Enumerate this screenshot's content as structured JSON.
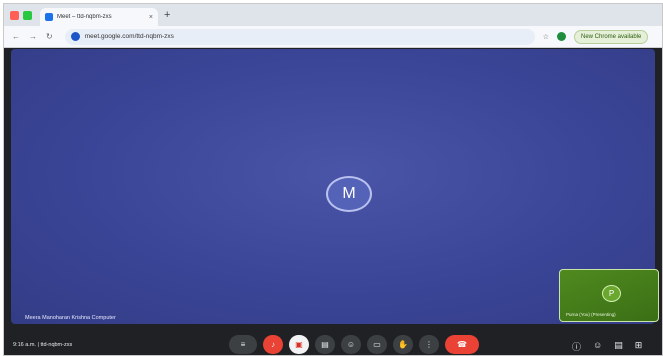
{
  "browser": {
    "tab_title": "Meet – ttd-nqbm-zxs",
    "tab_close": "×",
    "new_tab": "+",
    "url": "meet.google.com/ttd-nqbm-zxs",
    "profile": "New Chrome available",
    "nav": {
      "back": "←",
      "forward": "→",
      "reload": "↻"
    }
  },
  "meeting": {
    "main_avatar_initial": "M",
    "main_participant_name": "Meera Manoharan Krishna Computer",
    "self_avatar_initial": "P",
    "self_label": "Purna (You) (Presenting)",
    "time": "9:16 a.m.",
    "separator": "|",
    "meeting_code": "ttd-nqbm-zxs"
  },
  "controls": [
    {
      "id": "cc",
      "glyph": "≡"
    },
    {
      "id": "mic",
      "glyph": "♪"
    },
    {
      "id": "camera",
      "glyph": "▣"
    },
    {
      "id": "captions",
      "glyph": "▤"
    },
    {
      "id": "emoji",
      "glyph": "☺"
    },
    {
      "id": "present",
      "glyph": "▭"
    },
    {
      "id": "raise-hand",
      "glyph": "✋"
    },
    {
      "id": "more",
      "glyph": "⋮"
    },
    {
      "id": "leave",
      "glyph": "☎"
    }
  ],
  "right_icons": [
    "ⓘ",
    "☺",
    "▤",
    "⊞"
  ],
  "colors": {
    "stage": "#3b4597",
    "leave": "#ea4335",
    "self_tile": "#4f8a1f"
  }
}
